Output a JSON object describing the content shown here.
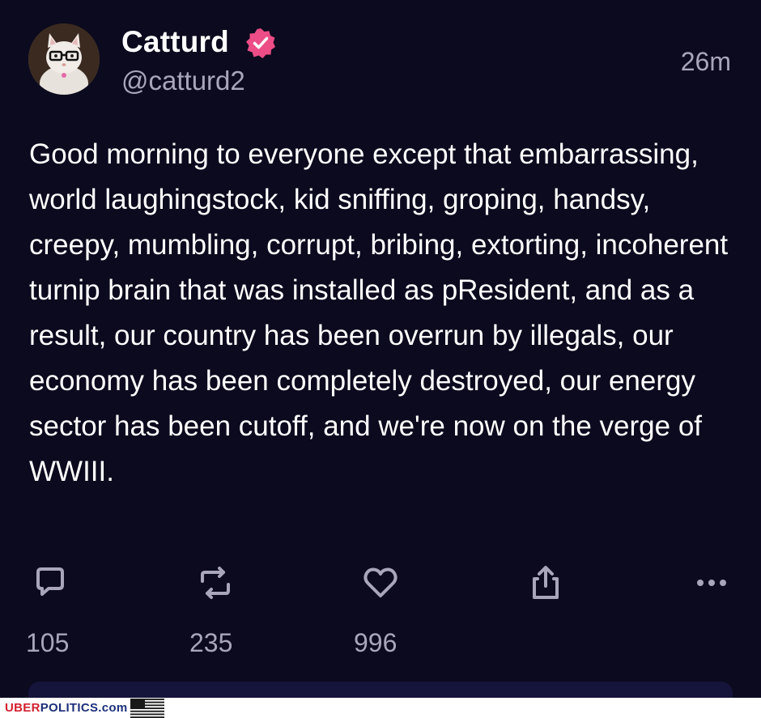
{
  "post": {
    "author": {
      "display_name": "Catturd",
      "handle": "@catturd2",
      "verified_icon": "verified-badge-icon",
      "avatar": "cat-with-glasses-avatar"
    },
    "timestamp": "26m",
    "text": "Good morning to everyone except that embarrassing, world laughingstock, kid sniffing, groping, handsy, creepy, mumbling, corrupt, bribing, extorting, incoherent turnip brain that was installed as pResident, and as a result, our country has been overrun by illegals, our economy has been completely destroyed, our energy sector has been cutoff, and we're now on the verge of WWIII.",
    "actions": {
      "reply": {
        "icon": "reply-icon",
        "count": "105"
      },
      "repost": {
        "icon": "repost-icon",
        "count": "235"
      },
      "like": {
        "icon": "heart-icon",
        "count": "996"
      },
      "share": {
        "icon": "share-icon"
      },
      "more": {
        "icon": "more-options-icon"
      }
    }
  },
  "watermark": {
    "uber": "UBER",
    "politics": "POLITICS.com",
    "flag_icon": "us-flag-icon"
  },
  "colors": {
    "background": "#0b0a1e",
    "primary_text": "#ffffff",
    "secondary_text": "#a9a6bb",
    "verified_badge": "#ec4d86"
  }
}
